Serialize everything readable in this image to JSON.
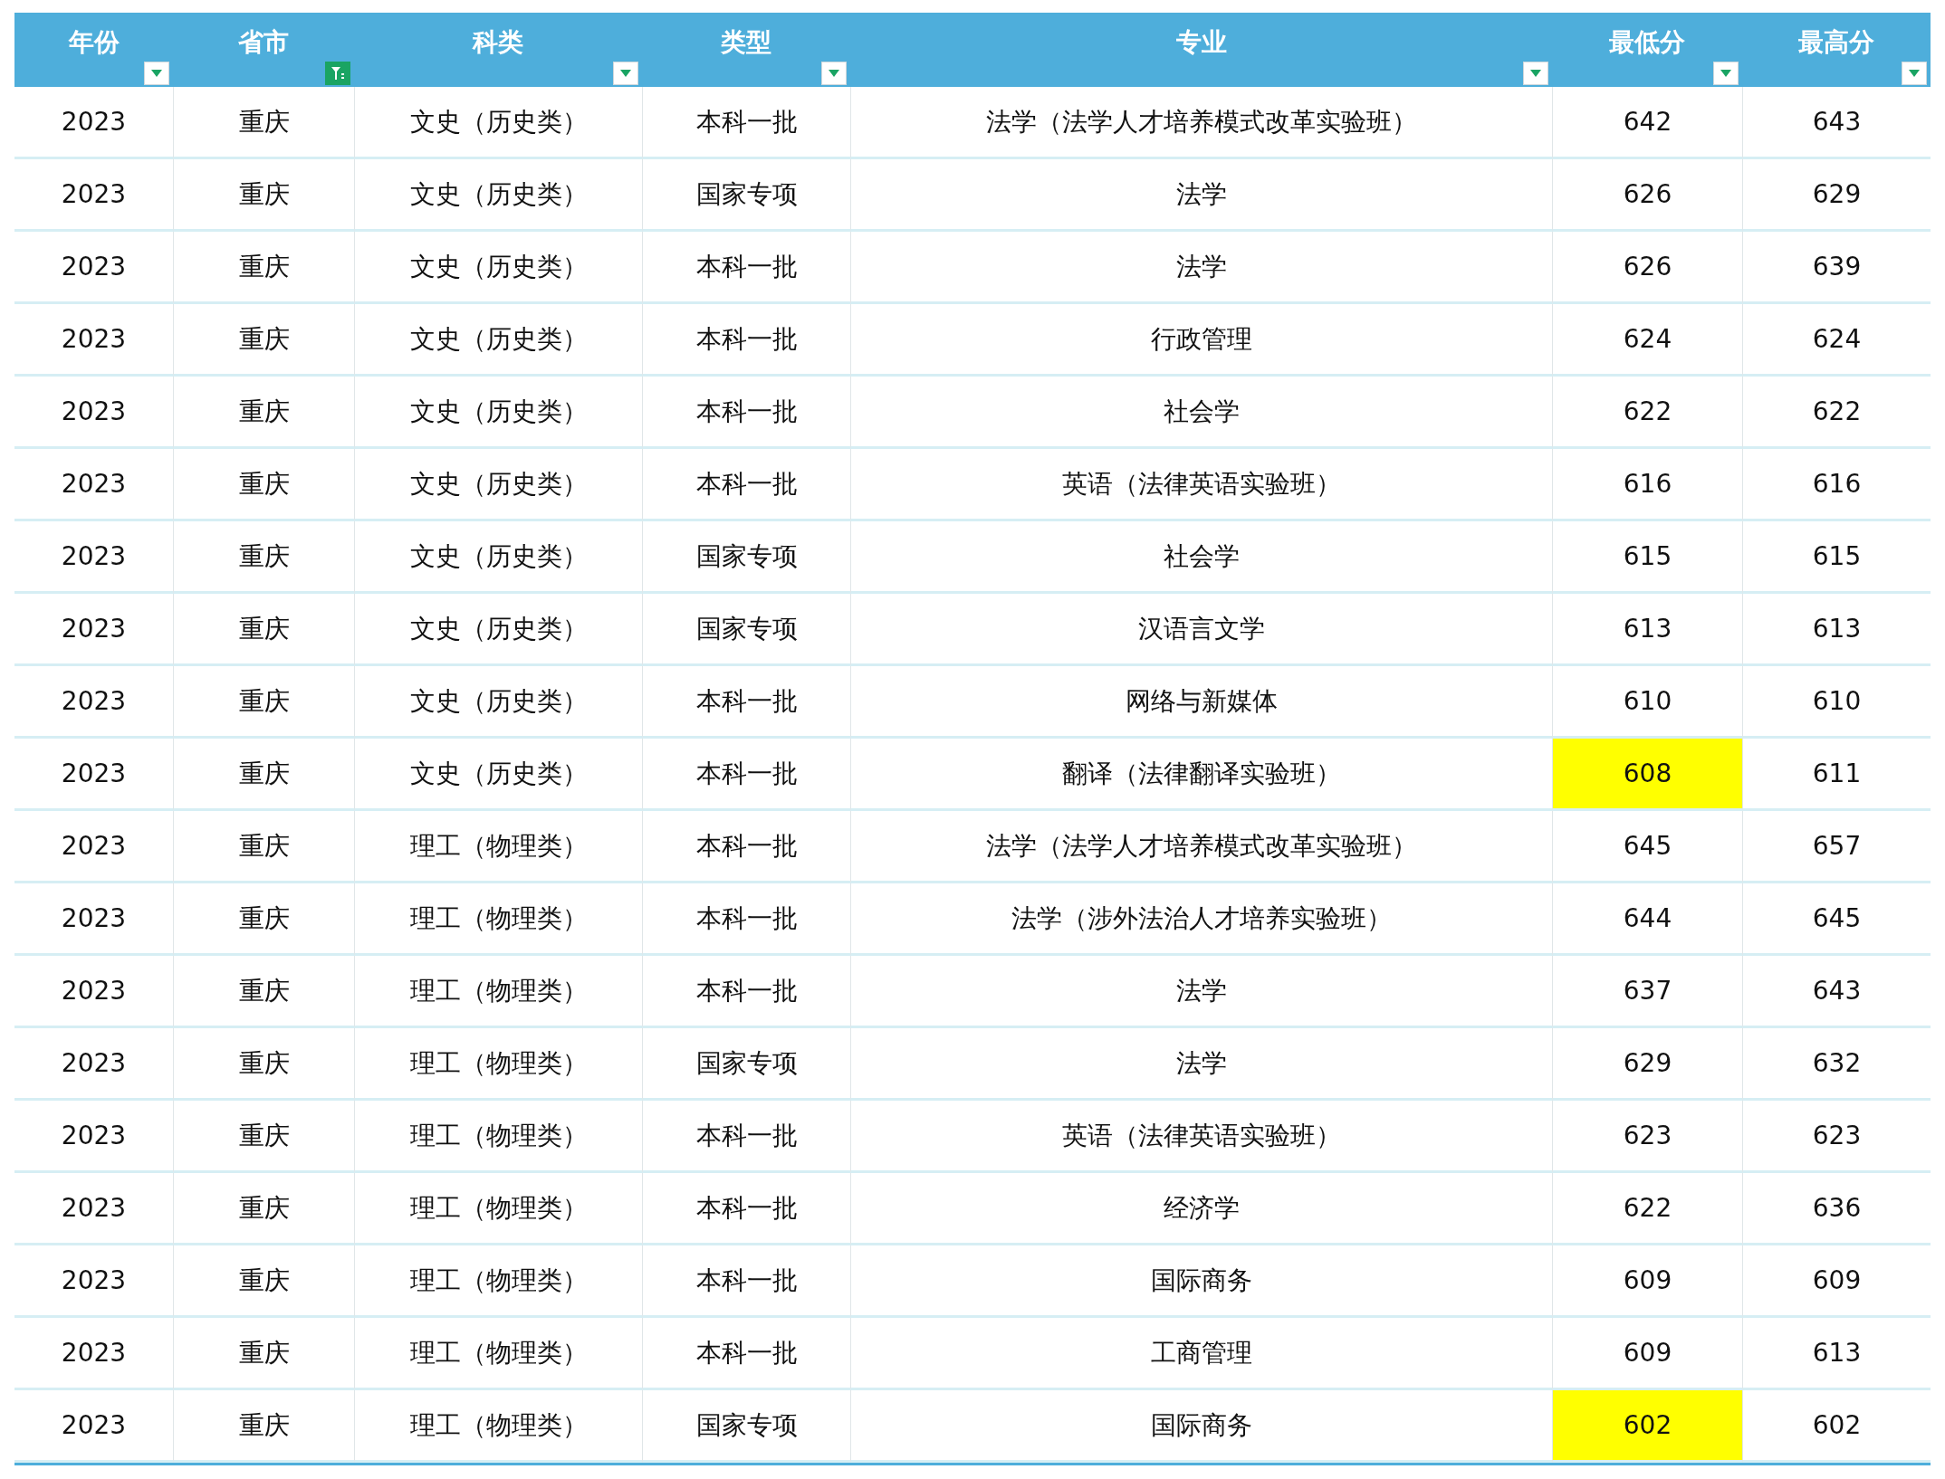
{
  "columns": [
    {
      "label": "年份",
      "filter_active": false
    },
    {
      "label": "省市",
      "filter_active": true
    },
    {
      "label": "科类",
      "filter_active": false
    },
    {
      "label": "类型",
      "filter_active": false
    },
    {
      "label": "专业",
      "filter_active": false
    },
    {
      "label": "最低分",
      "filter_active": false
    },
    {
      "label": "最高分",
      "filter_active": false
    }
  ],
  "rows": [
    {
      "cells": [
        "2023",
        "重庆",
        "文史（历史类）",
        "本科一批",
        "法学（法学人才培养模式改革实验班）",
        "642",
        "643"
      ],
      "min_score_highlighted": false
    },
    {
      "cells": [
        "2023",
        "重庆",
        "文史（历史类）",
        "国家专项",
        "法学",
        "626",
        "629"
      ],
      "min_score_highlighted": false
    },
    {
      "cells": [
        "2023",
        "重庆",
        "文史（历史类）",
        "本科一批",
        "法学",
        "626",
        "639"
      ],
      "min_score_highlighted": false
    },
    {
      "cells": [
        "2023",
        "重庆",
        "文史（历史类）",
        "本科一批",
        "行政管理",
        "624",
        "624"
      ],
      "min_score_highlighted": false
    },
    {
      "cells": [
        "2023",
        "重庆",
        "文史（历史类）",
        "本科一批",
        "社会学",
        "622",
        "622"
      ],
      "min_score_highlighted": false
    },
    {
      "cells": [
        "2023",
        "重庆",
        "文史（历史类）",
        "本科一批",
        "英语（法律英语实验班）",
        "616",
        "616"
      ],
      "min_score_highlighted": false
    },
    {
      "cells": [
        "2023",
        "重庆",
        "文史（历史类）",
        "国家专项",
        "社会学",
        "615",
        "615"
      ],
      "min_score_highlighted": false
    },
    {
      "cells": [
        "2023",
        "重庆",
        "文史（历史类）",
        "国家专项",
        "汉语言文学",
        "613",
        "613"
      ],
      "min_score_highlighted": false
    },
    {
      "cells": [
        "2023",
        "重庆",
        "文史（历史类）",
        "本科一批",
        "网络与新媒体",
        "610",
        "610"
      ],
      "min_score_highlighted": false
    },
    {
      "cells": [
        "2023",
        "重庆",
        "文史（历史类）",
        "本科一批",
        "翻译（法律翻译实验班）",
        "608",
        "611"
      ],
      "min_score_highlighted": true
    },
    {
      "cells": [
        "2023",
        "重庆",
        "理工（物理类）",
        "本科一批",
        "法学（法学人才培养模式改革实验班）",
        "645",
        "657"
      ],
      "min_score_highlighted": false
    },
    {
      "cells": [
        "2023",
        "重庆",
        "理工（物理类）",
        "本科一批",
        "法学（涉外法治人才培养实验班）",
        "644",
        "645"
      ],
      "min_score_highlighted": false
    },
    {
      "cells": [
        "2023",
        "重庆",
        "理工（物理类）",
        "本科一批",
        "法学",
        "637",
        "643"
      ],
      "min_score_highlighted": false
    },
    {
      "cells": [
        "2023",
        "重庆",
        "理工（物理类）",
        "国家专项",
        "法学",
        "629",
        "632"
      ],
      "min_score_highlighted": false
    },
    {
      "cells": [
        "2023",
        "重庆",
        "理工（物理类）",
        "本科一批",
        "英语（法律英语实验班）",
        "623",
        "623"
      ],
      "min_score_highlighted": false
    },
    {
      "cells": [
        "2023",
        "重庆",
        "理工（物理类）",
        "本科一批",
        "经济学",
        "622",
        "636"
      ],
      "min_score_highlighted": false
    },
    {
      "cells": [
        "2023",
        "重庆",
        "理工（物理类）",
        "本科一批",
        "国际商务",
        "609",
        "609"
      ],
      "min_score_highlighted": false
    },
    {
      "cells": [
        "2023",
        "重庆",
        "理工（物理类）",
        "本科一批",
        "工商管理",
        "609",
        "613"
      ],
      "min_score_highlighted": false
    },
    {
      "cells": [
        "2023",
        "重庆",
        "理工（物理类）",
        "国家专项",
        "国际商务",
        "602",
        "602"
      ],
      "min_score_highlighted": true
    }
  ]
}
